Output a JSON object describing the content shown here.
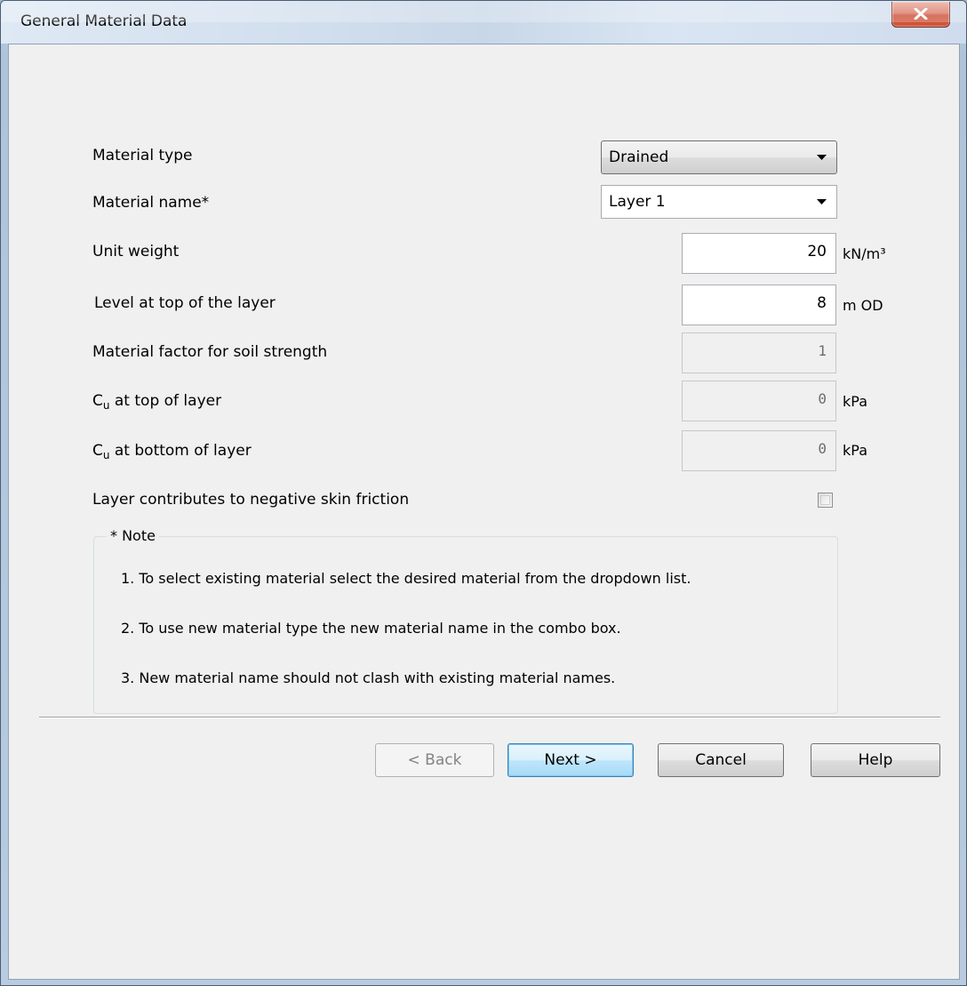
{
  "window": {
    "title": "General Material Data"
  },
  "fields": {
    "material_type": {
      "label": "Material type",
      "value": "Drained"
    },
    "material_name": {
      "label": "Material name*",
      "value": "Layer 1"
    },
    "unit_weight": {
      "label": "Unit weight",
      "value": "20",
      "unit": "kN/m³"
    },
    "level_top": {
      "label": "Level at top of the layer",
      "value": "8",
      "unit": "m OD"
    },
    "material_factor": {
      "label": "Material factor for soil strength",
      "value": "1"
    },
    "cu_top": {
      "label_main": "C",
      "label_sub": "u",
      "label_rest": " at top of layer",
      "value": "0",
      "unit": "kPa"
    },
    "cu_bottom": {
      "label_main": "C",
      "label_sub": "u",
      "label_rest": " at bottom of layer",
      "value": "0",
      "unit": "kPa"
    },
    "negative_skin": {
      "label": "Layer contributes to negative skin friction",
      "checked": false
    }
  },
  "note": {
    "title": "* Note",
    "items": [
      "1. To select existing material select the desired material from the dropdown list.",
      "2. To use new material type the new material name in the combo box.",
      "3. New material name should not clash with existing material names."
    ]
  },
  "buttons": {
    "back": "< Back",
    "next": "Next >",
    "cancel": "Cancel",
    "help": "Help"
  }
}
